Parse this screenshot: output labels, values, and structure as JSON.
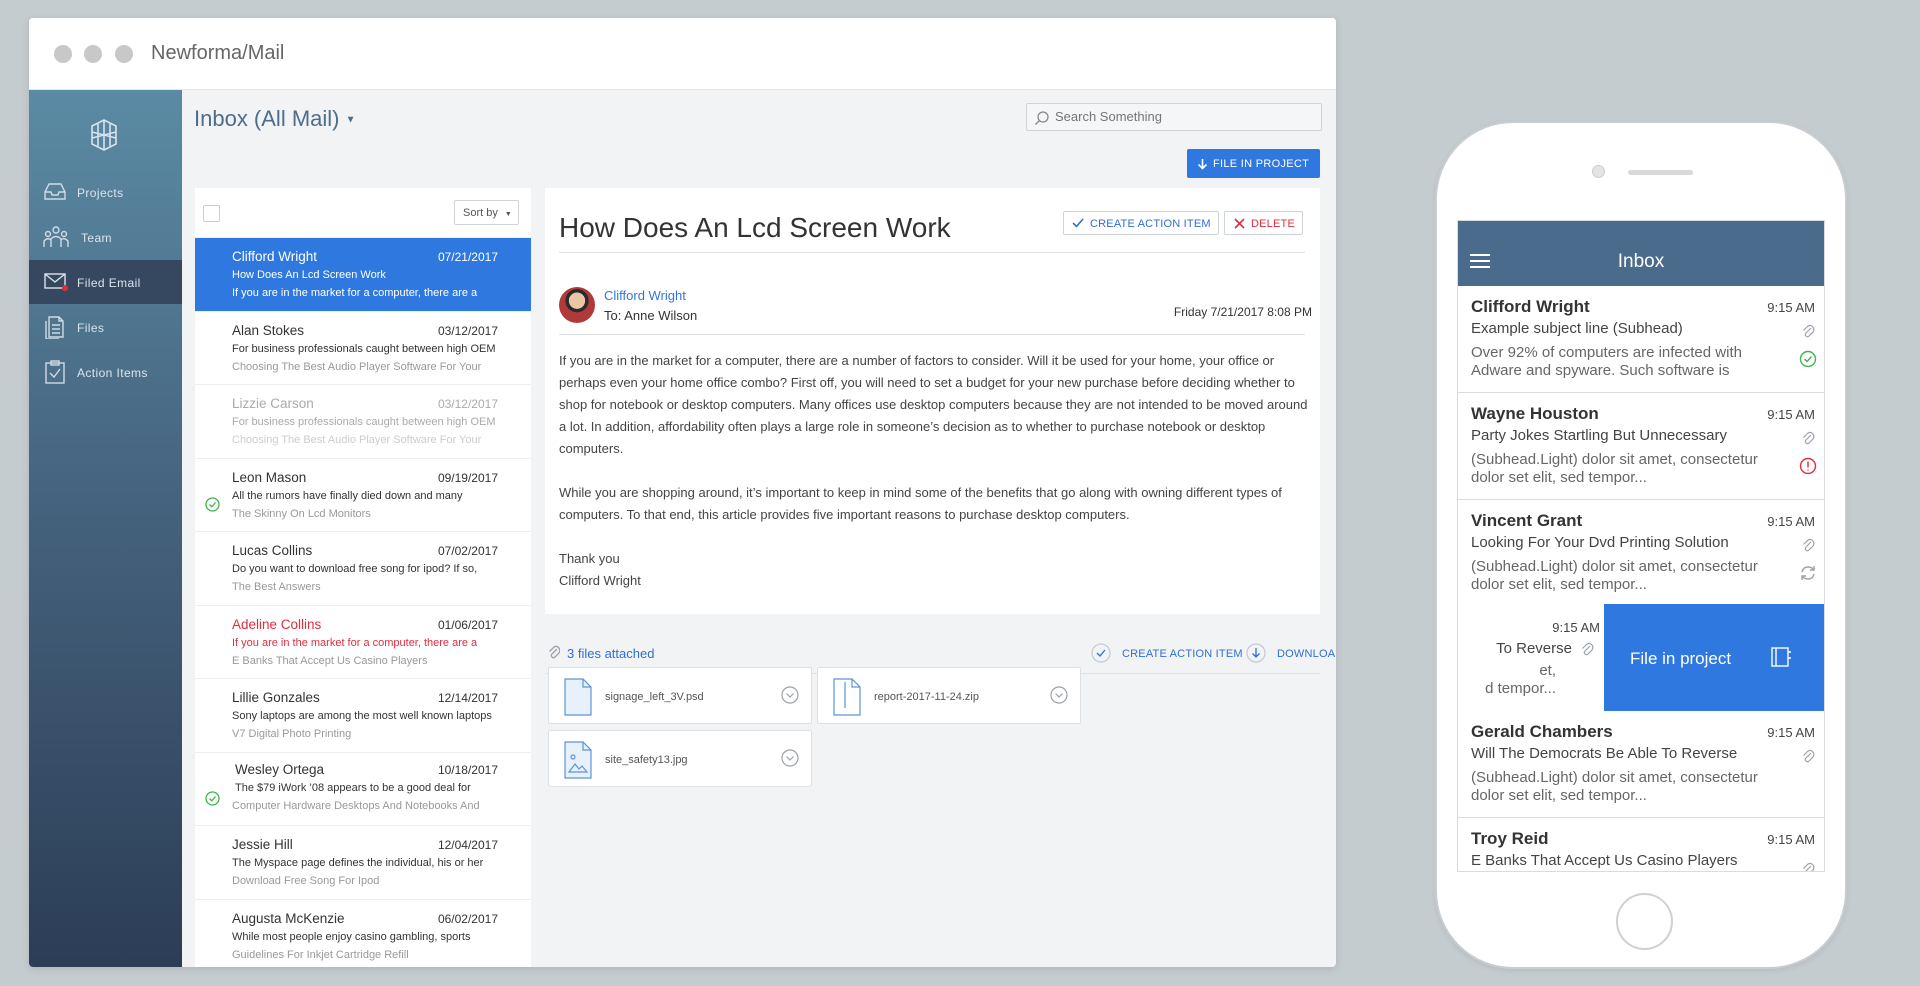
{
  "window": {
    "title": "Newforma/Mail"
  },
  "sidebar": {
    "items": [
      {
        "label": "Projects",
        "icon": "tray-icon"
      },
      {
        "label": "Team",
        "icon": "team-icon"
      },
      {
        "label": "Filed Email",
        "icon": "envelope-icon",
        "active": true
      },
      {
        "label": "Files",
        "icon": "files-icon"
      },
      {
        "label": "Action Items",
        "icon": "clipboard-check-icon"
      }
    ]
  },
  "toolbar": {
    "mailbox": "Inbox (All Mail)",
    "search_placeholder": "Search Something",
    "file_in_project": "FILE IN PROJECT"
  },
  "list": {
    "sort_label": "Sort by",
    "rows": [
      {
        "name": "Clifford Wright",
        "date": "07/21/2017",
        "subject": "How Does An Lcd Screen Work",
        "preview": "If you are in the market for a computer, there are a"
      },
      {
        "name": "Alan Stokes",
        "date": "03/12/2017",
        "subject": "For business professionals caught between high OEM",
        "preview": "Choosing The Best Audio Player Software For Your"
      },
      {
        "name": "Lizzie Carson",
        "date": "03/12/2017",
        "subject": "For business professionals caught between high OEM",
        "preview": "Choosing The Best Audio Player Software For Your"
      },
      {
        "name": "Leon Mason",
        "date": "09/19/2017",
        "subject": "All the rumors have finally died down and many",
        "preview": "The Skinny On Lcd Monitors"
      },
      {
        "name": "Lucas Collins",
        "date": "07/02/2017",
        "subject": "Do you want to download free song for ipod? If so,",
        "preview": "The Best Answers"
      },
      {
        "name": "Adeline Collins",
        "date": "01/06/2017",
        "subject": "If you are in the market for a computer, there are a",
        "preview": "E Banks That Accept Us Casino Players"
      },
      {
        "name": "Lillie Gonzales",
        "date": "12/14/2017",
        "subject": "Sony laptops are among the most well known laptops",
        "preview": "V7 Digital Photo Printing"
      },
      {
        "name": "Wesley Ortega",
        "date": "10/18/2017",
        "subject": "The $79 iWork ’08 appears to be a good deal for",
        "preview": "Computer Hardware Desktops And Notebooks And"
      },
      {
        "name": "Jessie Hill",
        "date": "12/04/2017",
        "subject": "The Myspace page defines the individual, his or her",
        "preview": "Download Free Song For Ipod"
      },
      {
        "name": "Augusta McKenzie",
        "date": "06/02/2017",
        "subject": "While most people enjoy casino gambling, sports",
        "preview": "Guidelines For Inkjet Cartridge Refill"
      }
    ]
  },
  "message": {
    "subject": "How Does An Lcd Screen Work",
    "create_action_label": "CREATE ACTION ITEM",
    "delete_label": "DELETE",
    "sender": "Clifford Wright",
    "to": "To: Anne Wilson",
    "date": "Friday 7/21/2017 8:08 PM",
    "paragraph1": "If you are in the market for a computer, there are a number of factors to consider. Will it be used for your home, your office or perhaps even your home office combo? First off, you will need to set a budget for your new purchase before deciding whether to shop for notebook or desktop computers. Many offices use desktop computers because they are not intended to be moved around a lot. In addition, affordability often plays a large role in someone’s decision as to whether to purchase notebook or desktop computers.",
    "paragraph2": "While you are shopping around, it’s important to keep in mind some of the benefits that go along with owning different types of computers. To that end, this article provides five important reasons to purchase desktop computers.",
    "signoff1": "Thank you",
    "signoff2": "Clifford Wright"
  },
  "attachments": {
    "count_label": "3 files attached",
    "create_action_label": "CREATE ACTION ITEM",
    "download_label": "DOWNLOAD",
    "files": [
      {
        "name": "signage_left_3V.psd",
        "icon": "document-icon"
      },
      {
        "name": "report-2017-11-24.zip",
        "icon": "zip-icon"
      },
      {
        "name": "site_safety13.jpg",
        "icon": "image-file-icon"
      }
    ]
  },
  "phone": {
    "title": "Inbox",
    "rows": [
      {
        "name": "Clifford Wright",
        "time": "9:15 AM",
        "subject": "Example subject line (Subhead)",
        "preview": "Over 92% of computers are infected with Adware and spyware. Such software is",
        "status": "check-circle-icon"
      },
      {
        "name": "Wayne Houston",
        "time": "9:15 AM",
        "subject": "Party Jokes Startling But Unnecessary",
        "preview": "(Subhead.Light) dolor sit amet, consectetur dolor set elit, sed tempor...",
        "status": "alert-circle-icon"
      },
      {
        "name": "Vincent Grant",
        "time": "9:15 AM",
        "subject": "Looking For Your Dvd Printing Solution",
        "preview": "(Subhead.Light) dolor sit amet, consectetur dolor set elit, sed tempor...",
        "status": "sync-icon"
      },
      {
        "name": "Gerald Chambers",
        "time": "9:15 AM",
        "subject": "Will The Democrats Be Able To Reverse",
        "preview": "(Subhead.Light) dolor sit amet, consectetur dolor set elit, sed tempor..."
      },
      {
        "name": "Troy Reid",
        "time": "9:15 AM",
        "subject": "E Banks That Accept Us Casino Players",
        "preview": ""
      }
    ],
    "swiped": {
      "time": "9:15 AM",
      "subject_fragment": "To Reverse",
      "line1": "et,",
      "line2": "d tempor...",
      "action": "File in project"
    }
  },
  "colors": {
    "accent": "#2f78e0",
    "danger": "#e02d40",
    "success": "#3cb54a",
    "sidebar_top": "#5b8ba4",
    "sidebar_bottom": "#2c3d56"
  }
}
